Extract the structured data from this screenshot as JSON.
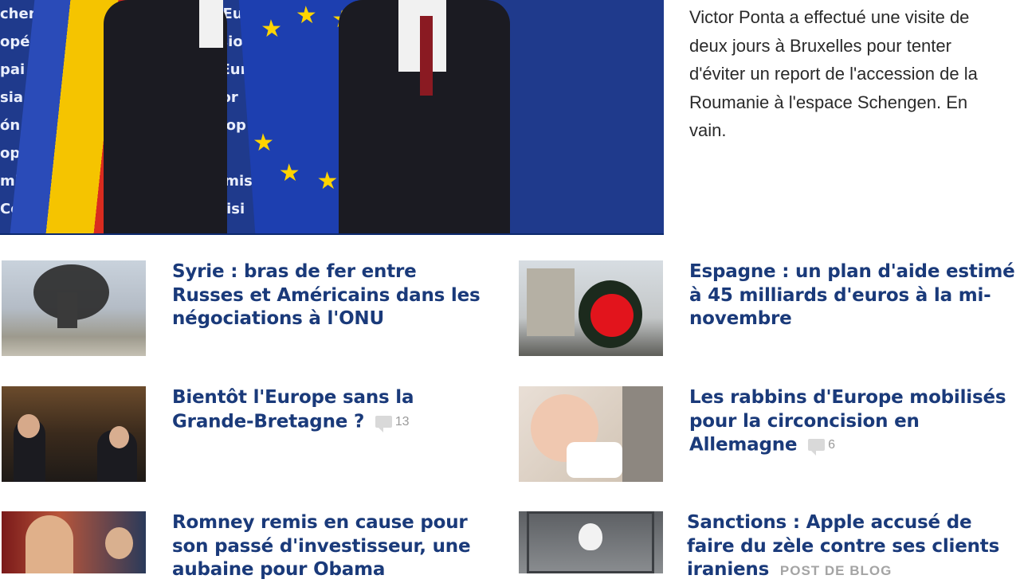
{
  "hero": {
    "background_text": [
      "chen Eur   Europska komisia  Európska komisia  Evrops",
      "opéer   Europäische Kommission  Ev",
      "pai Eur   Comissão Europeia  Eur",
      "sia   Kommissjoni Ewropea  Kor",
      "ón Europea   Commission  Europ",
      "opska k   Commissione  Europ",
      "misia Evrop   ság  Európos Komisija  Eir",
      "   Comisia Europeană  An Coimisi"
    ],
    "caption": "Victor Ponta a effectué une visite de deux jours à Bruxelles pour tenter d'éviter un report de l'accession de la Roumanie à l'espace Schengen. En vain."
  },
  "articles": [
    {
      "headline": "Syrie : bras de fer entre Russes et Américains dans les négociations à l'ONU"
    },
    {
      "headline": "Espagne : un plan d'aide estimé à 45 milliards d'euros à la mi-novembre"
    },
    {
      "headline": "Bientôt l'Europe sans la Grande-Bretagne ?",
      "comments": "13"
    },
    {
      "headline": "Les rabbins d'Europe mobilisés pour la circoncision en Allemagne",
      "comments": "6"
    },
    {
      "headline": "Romney remis en cause pour son passé d'investisseur, une aubaine pour Obama"
    },
    {
      "headline": "Sanctions : Apple accusé de faire du zèle contre ses clients iraniens",
      "tag": "POST DE BLOG"
    }
  ],
  "colors": {
    "headline": "#1a3a7a",
    "caption": "#2a2a2a",
    "meta": "#9a9a9a",
    "hero_blue": "#1f3a8c"
  },
  "icons": [
    "comment-bubble-icon"
  ]
}
